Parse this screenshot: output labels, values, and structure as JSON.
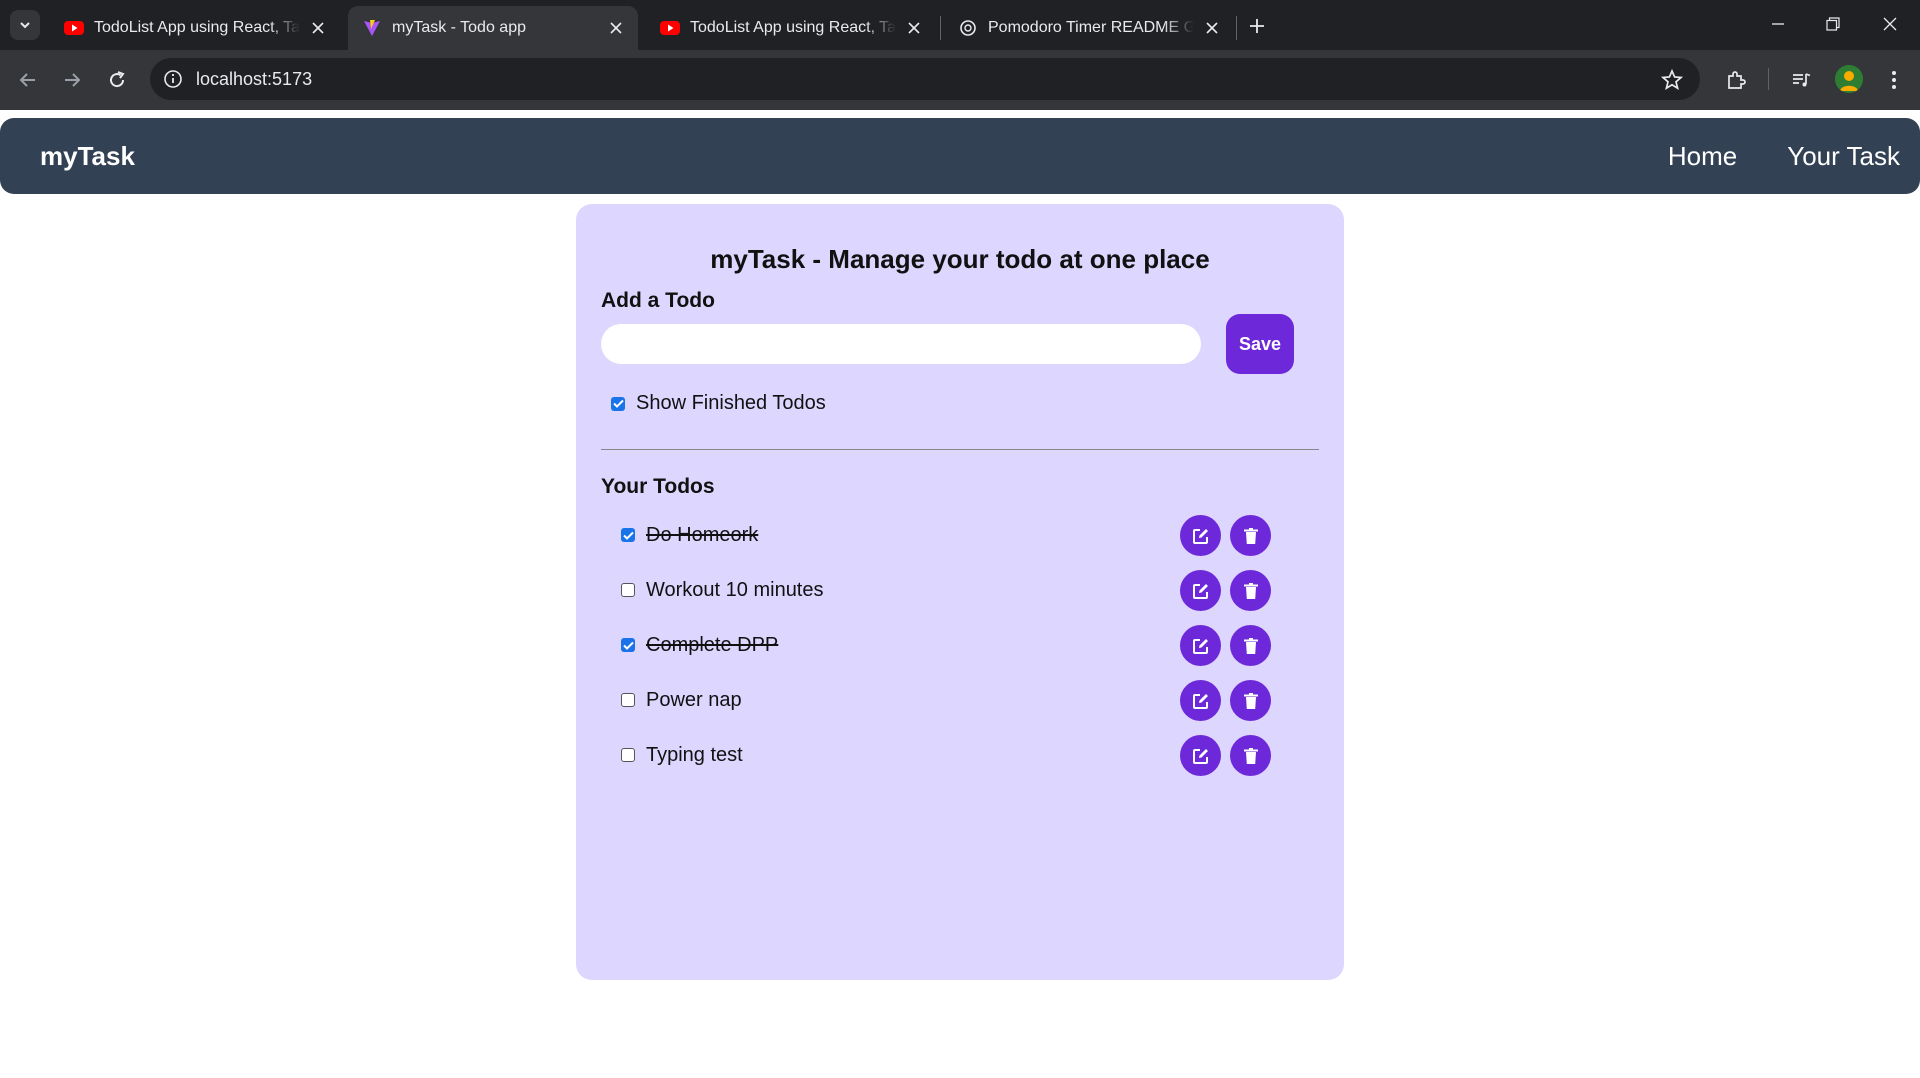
{
  "browser": {
    "tabs": [
      {
        "title": "TodoList App using React, Tailwind",
        "favicon": "youtube-icon",
        "active": false
      },
      {
        "title": "myTask - Todo app",
        "favicon": "vite-icon",
        "active": true
      },
      {
        "title": "TodoList App using React, Tailwind",
        "favicon": "youtube-icon",
        "active": false
      },
      {
        "title": "Pomodoro Timer README Guide",
        "favicon": "chatgpt-icon",
        "active": false
      }
    ],
    "url": "localhost:5173"
  },
  "navbar": {
    "brand": "myTask",
    "links": [
      "Home",
      "Your Task"
    ]
  },
  "main": {
    "title": "myTask - Manage your todo at one place",
    "add_label": "Add a Todo",
    "input_value": "",
    "save_label": "Save",
    "show_finished": {
      "label": "Show Finished Todos",
      "checked": true
    },
    "todos_heading": "Your Todos",
    "todos": [
      {
        "text": "Do Homeork",
        "done": true
      },
      {
        "text": "Workout 10 minutes",
        "done": false
      },
      {
        "text": "Complete DPP",
        "done": true
      },
      {
        "text": "Power nap",
        "done": false
      },
      {
        "text": "Typing test",
        "done": false
      }
    ]
  },
  "colors": {
    "navbar": "#334155",
    "card": "#ddd6fe",
    "accent": "#6d28d9",
    "checkbox": "#1a73e8"
  }
}
